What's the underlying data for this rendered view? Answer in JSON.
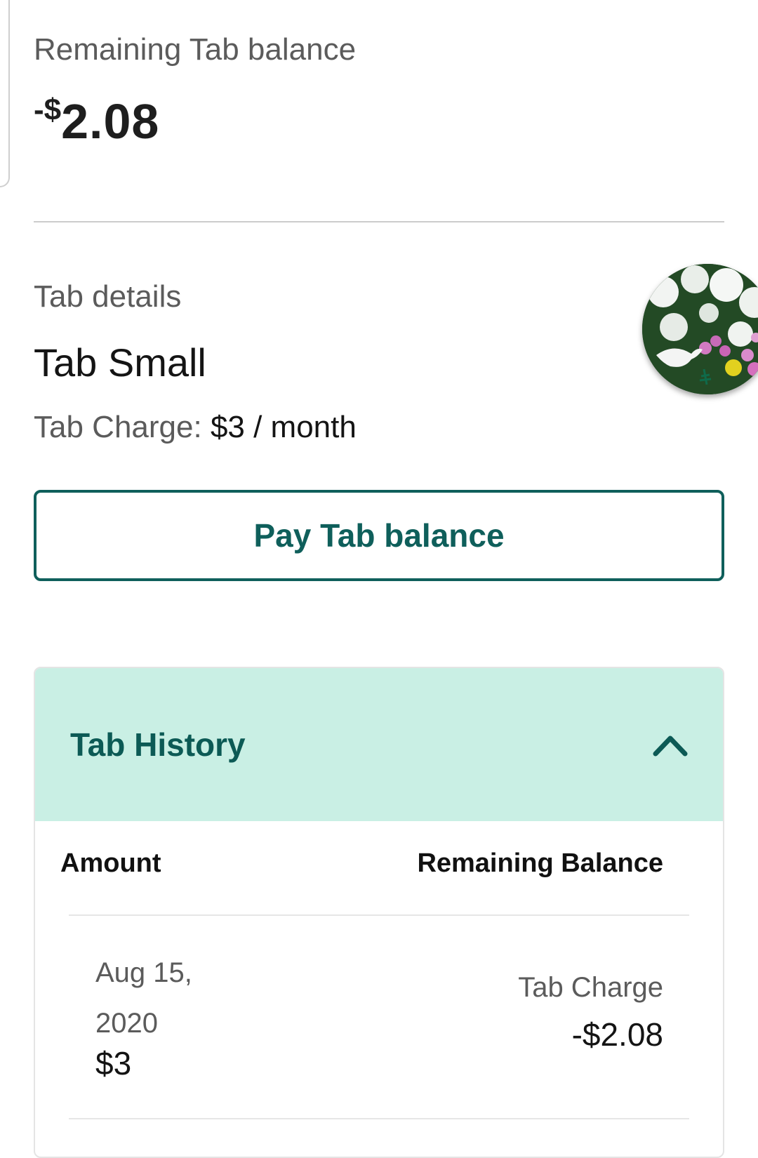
{
  "balance": {
    "label": "Remaining Tab balance",
    "sign": "-$",
    "amount": "2.08"
  },
  "details": {
    "label": "Tab details",
    "plan_name": "Tab Small",
    "charge_label": "Tab Charge:",
    "charge_value": "$3 / month",
    "avatar_icon": "profile-photo-flowers"
  },
  "pay_button": {
    "label": "Pay Tab balance"
  },
  "history": {
    "title": "Tab History",
    "expanded": true,
    "columns": {
      "amount": "Amount",
      "remaining": "Remaining Balance"
    },
    "rows": [
      {
        "date": "Aug 15, 2020",
        "amount": "$3",
        "type": "Tab Charge",
        "balance": "-$2.08"
      }
    ]
  },
  "colors": {
    "accent": "#0f5f5b",
    "history_header_bg": "#c9efe4",
    "muted_text": "#5b5b5b"
  }
}
